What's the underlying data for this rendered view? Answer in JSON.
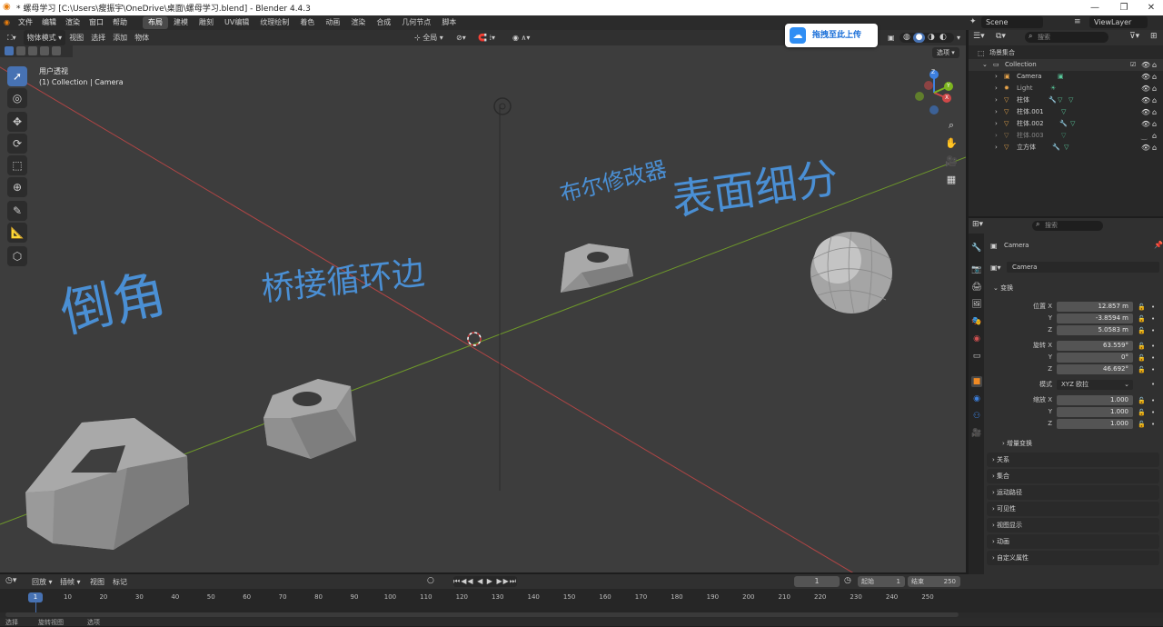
{
  "window": {
    "title": "* 螺母学习 [C:\\Users\\瘦振宇\\OneDrive\\桌面\\螺母学习.blend] - Blender 4.4.3",
    "minimize": "—",
    "maximize": "❐",
    "close": "✕"
  },
  "menu": {
    "items": [
      "文件",
      "编辑",
      "渲染",
      "窗口",
      "帮助"
    ],
    "workspaces": [
      "布局",
      "建模",
      "雕刻",
      "UV编辑",
      "纹理绘制",
      "着色",
      "动画",
      "渲染",
      "合成",
      "几何节点",
      "脚本"
    ],
    "active_workspace": "布局",
    "scene_label": "Scene",
    "viewlayer_label": "ViewLayer"
  },
  "viewport_header": {
    "mode": "物体模式",
    "menus": [
      "视图",
      "选择",
      "添加",
      "物体"
    ],
    "transform_orientation": "全局",
    "options": "选项"
  },
  "upload_badge": {
    "label": "拖拽至此上传"
  },
  "viewport": {
    "view_name": "用户透视",
    "collection_info": "(1) Collection | Camera",
    "gizmo": {
      "x": "X",
      "y": "Y",
      "z": "Z"
    },
    "tools": [
      "select-box",
      "cursor",
      "move",
      "rotate",
      "scale",
      "transform",
      "annotate",
      "measure",
      "add-cube"
    ],
    "handwriting": {
      "note1": "倒角",
      "note2": "桥接循环边",
      "note3": "布尔修改器",
      "note4": "表面细分"
    }
  },
  "outliner": {
    "search_placeholder": "搜索",
    "scene_collection": "场景集合",
    "collection": "Collection",
    "items": [
      {
        "name": "Camera",
        "type": "camera"
      },
      {
        "name": "Light",
        "type": "light"
      },
      {
        "name": "柱体",
        "type": "mesh"
      },
      {
        "name": "柱体.001",
        "type": "mesh"
      },
      {
        "name": "柱体.002",
        "type": "mesh"
      },
      {
        "name": "柱体.003",
        "type": "mesh",
        "hidden": true
      },
      {
        "name": "立方体",
        "type": "mesh"
      }
    ]
  },
  "properties": {
    "search_placeholder": "搜索",
    "object_name": "Camera",
    "object_datablock": "Camera",
    "transform_section": "变换",
    "location_label": "位置",
    "rotation_label": "旋转",
    "scale_label": "缩放",
    "mode_label": "模式",
    "location": {
      "x": "12.857 m",
      "y": "-3.8594 m",
      "z": "5.0583 m"
    },
    "rotation": {
      "x": "63.559°",
      "y": "0°",
      "z": "46.692°"
    },
    "rotation_mode": "XYZ 欧拉",
    "scale": {
      "x": "1.000",
      "y": "1.000",
      "z": "1.000"
    },
    "axis": {
      "x": "X",
      "y": "Y",
      "z": "Z"
    },
    "delta_transform": "增量变换",
    "sections": [
      "关系",
      "集合",
      "运动路径",
      "可见性",
      "视图显示",
      "动画",
      "自定义属性"
    ]
  },
  "timeline": {
    "menus": [
      "回放",
      "插帧",
      "视图",
      "标记"
    ],
    "current_frame": "1",
    "start_label": "起始",
    "start_value": "1",
    "end_label": "结束",
    "end_value": "250",
    "frame_numbers": [
      "10",
      "20",
      "30",
      "40",
      "50",
      "60",
      "70",
      "80",
      "90",
      "100",
      "110",
      "120",
      "130",
      "140",
      "150",
      "160",
      "170",
      "180",
      "190",
      "200",
      "210",
      "220",
      "230",
      "240",
      "250"
    ],
    "playhead": "1"
  },
  "statusbar": {
    "select": "选择",
    "pan": "旋转视图",
    "select2": "选项"
  },
  "colors": {
    "accent": "#4772b3",
    "x_axis": "#c94a4a",
    "y_axis": "#7fae2e",
    "sketch": "#4a8fd4"
  }
}
